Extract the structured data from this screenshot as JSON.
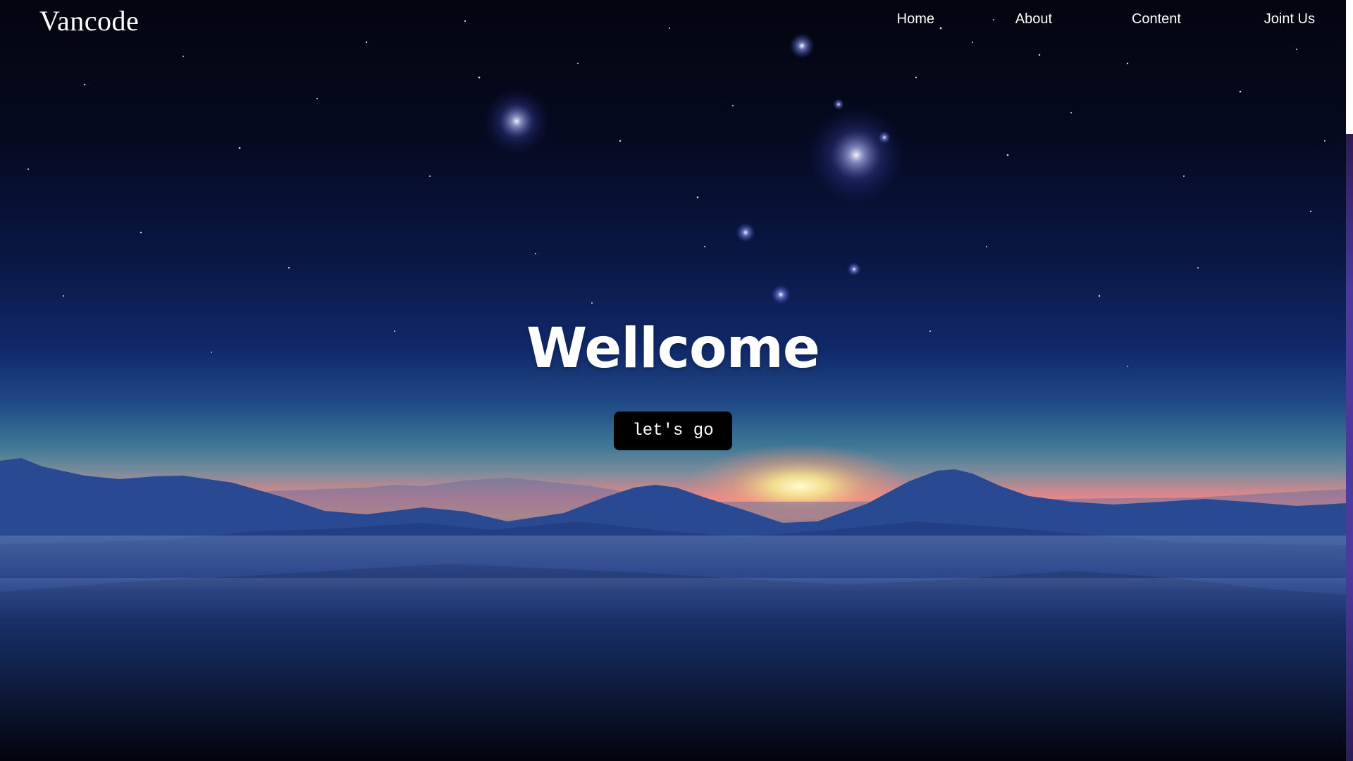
{
  "site": {
    "logo": "Vancode"
  },
  "nav": {
    "items": [
      {
        "label": "Home"
      },
      {
        "label": "About"
      },
      {
        "label": "Content"
      },
      {
        "label": "Joint Us"
      }
    ]
  },
  "hero": {
    "title": "Wellcome",
    "button_label": "let's go",
    "background": "night-sky-mountains-sunrise"
  },
  "colors": {
    "sky_top": "#03050f",
    "sky_mid": "#0d1f55",
    "horizon_glow": "#f6e58a",
    "mountain": "#2a4c94",
    "button_bg": "#000000",
    "scroll_thumb": "#4a3a9a"
  }
}
